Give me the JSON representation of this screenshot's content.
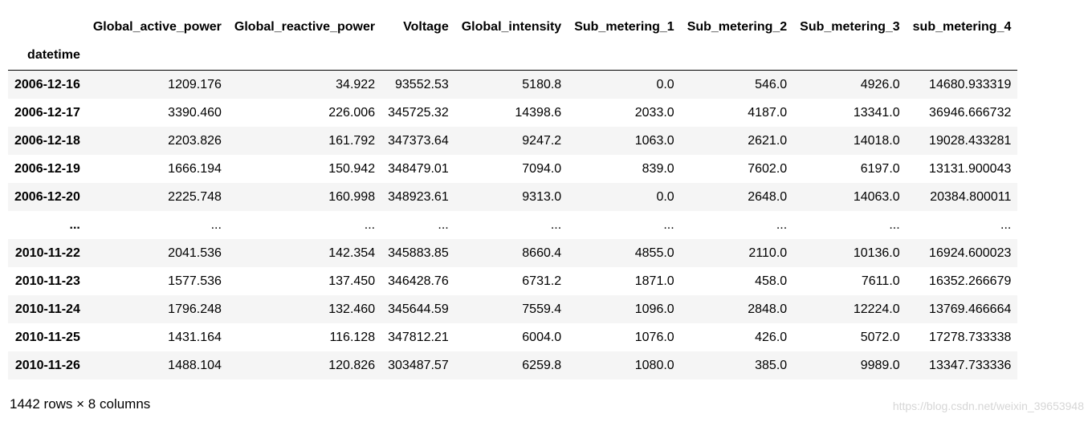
{
  "table": {
    "columns": [
      "Global_active_power",
      "Global_reactive_power",
      "Voltage",
      "Global_intensity",
      "Sub_metering_1",
      "Sub_metering_2",
      "Sub_metering_3",
      "sub_metering_4"
    ],
    "index_name": "datetime",
    "rows": [
      {
        "index": "2006-12-16",
        "cells": [
          "1209.176",
          "34.922",
          "93552.53",
          "5180.8",
          "0.0",
          "546.0",
          "4926.0",
          "14680.933319"
        ]
      },
      {
        "index": "2006-12-17",
        "cells": [
          "3390.460",
          "226.006",
          "345725.32",
          "14398.6",
          "2033.0",
          "4187.0",
          "13341.0",
          "36946.666732"
        ]
      },
      {
        "index": "2006-12-18",
        "cells": [
          "2203.826",
          "161.792",
          "347373.64",
          "9247.2",
          "1063.0",
          "2621.0",
          "14018.0",
          "19028.433281"
        ]
      },
      {
        "index": "2006-12-19",
        "cells": [
          "1666.194",
          "150.942",
          "348479.01",
          "7094.0",
          "839.0",
          "7602.0",
          "6197.0",
          "13131.900043"
        ]
      },
      {
        "index": "2006-12-20",
        "cells": [
          "2225.748",
          "160.998",
          "348923.61",
          "9313.0",
          "0.0",
          "2648.0",
          "14063.0",
          "20384.800011"
        ]
      },
      {
        "index": "...",
        "cells": [
          "...",
          "...",
          "...",
          "...",
          "...",
          "...",
          "...",
          "..."
        ]
      },
      {
        "index": "2010-11-22",
        "cells": [
          "2041.536",
          "142.354",
          "345883.85",
          "8660.4",
          "4855.0",
          "2110.0",
          "10136.0",
          "16924.600023"
        ]
      },
      {
        "index": "2010-11-23",
        "cells": [
          "1577.536",
          "137.450",
          "346428.76",
          "6731.2",
          "1871.0",
          "458.0",
          "7611.0",
          "16352.266679"
        ]
      },
      {
        "index": "2010-11-24",
        "cells": [
          "1796.248",
          "132.460",
          "345644.59",
          "7559.4",
          "1096.0",
          "2848.0",
          "12224.0",
          "13769.466664"
        ]
      },
      {
        "index": "2010-11-25",
        "cells": [
          "1431.164",
          "116.128",
          "347812.21",
          "6004.0",
          "1076.0",
          "426.0",
          "5072.0",
          "17278.733338"
        ]
      },
      {
        "index": "2010-11-26",
        "cells": [
          "1488.104",
          "120.826",
          "303487.57",
          "6259.8",
          "1080.0",
          "385.0",
          "9989.0",
          "13347.733336"
        ]
      }
    ]
  },
  "shape_text": "1442 rows × 8 columns",
  "watermark": "https://blog.csdn.net/weixin_39653948",
  "colors": {
    "stripe": "#f5f5f5",
    "header_rule": "#000000",
    "watermark": "#d6d6d6"
  }
}
